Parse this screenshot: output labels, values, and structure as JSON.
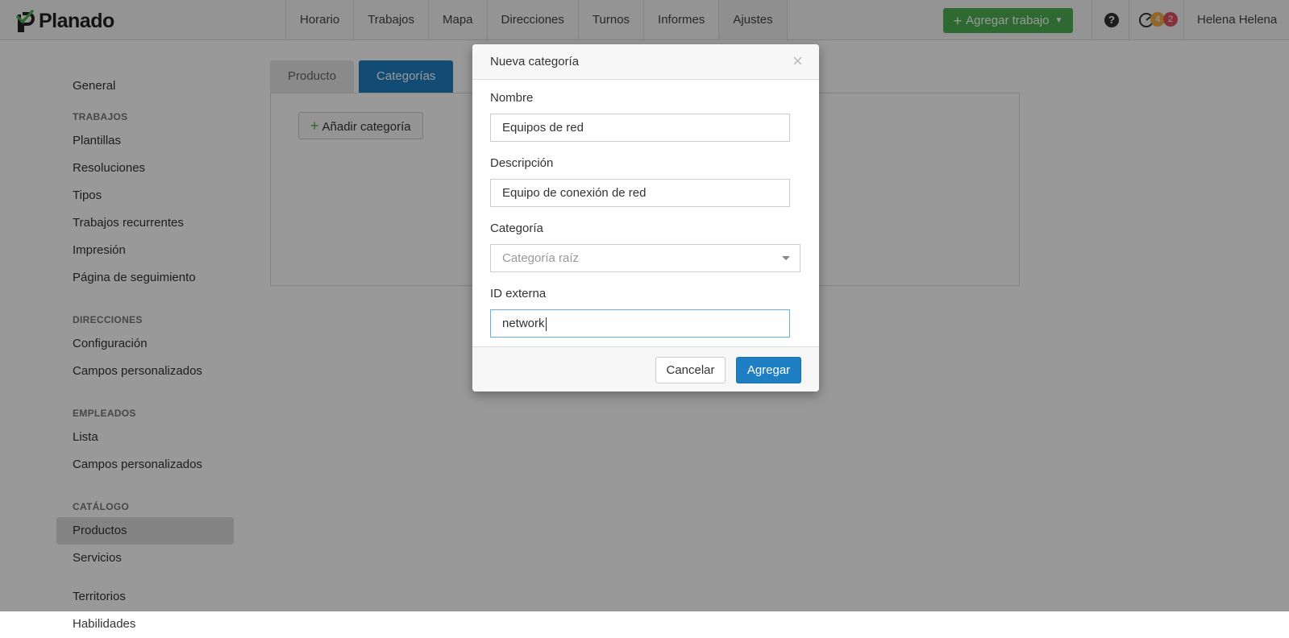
{
  "app": {
    "brand": "Planado"
  },
  "nav": {
    "items": [
      {
        "label": "Horario"
      },
      {
        "label": "Trabajos"
      },
      {
        "label": "Mapa"
      },
      {
        "label": "Direcciones"
      },
      {
        "label": "Turnos"
      },
      {
        "label": "Informes"
      },
      {
        "label": "Ajustes",
        "active": true
      }
    ],
    "add_job_label": "Agregar trabajo",
    "help_icon": "?",
    "badges": {
      "warning": "4",
      "danger": "2"
    },
    "user": "Helena Helena"
  },
  "sidebar": {
    "general": "General",
    "sections": [
      {
        "header": "TRABAJOS",
        "items": [
          "Plantillas",
          "Resoluciones",
          "Tipos",
          "Trabajos recurrentes",
          "Impresión",
          "Página de seguimiento"
        ]
      },
      {
        "header": "DIRECCIONES",
        "items": [
          "Configuración",
          "Campos personalizados"
        ]
      },
      {
        "header": "EMPLEADOS",
        "items": [
          "Lista",
          "Campos personalizados"
        ]
      },
      {
        "header": "CATÁLOGO",
        "items": [
          "Productos",
          "Servicios"
        ]
      }
    ],
    "extra": [
      "Territorios",
      "Habilidades"
    ]
  },
  "main": {
    "tabs": [
      {
        "label": "Producto"
      },
      {
        "label": "Categorías",
        "active": true
      }
    ],
    "add_category_label": "Añadir categoría"
  },
  "modal": {
    "title": "Nueva categoría",
    "close_icon": "×",
    "fields": {
      "name_label": "Nombre",
      "name_value": "Equipos de red",
      "description_label": "Descripción",
      "description_value": "Equipo de conexión de red",
      "category_label": "Categoría",
      "category_placeholder": "Categoría raíz",
      "external_id_label": "ID externa",
      "external_id_value": "network"
    },
    "cancel_label": "Cancelar",
    "submit_label": "Agregar"
  },
  "colors": {
    "primary": "#1f7fc4",
    "success": "#4caf50",
    "warning": "#f0ad4e",
    "danger": "#e05260"
  }
}
